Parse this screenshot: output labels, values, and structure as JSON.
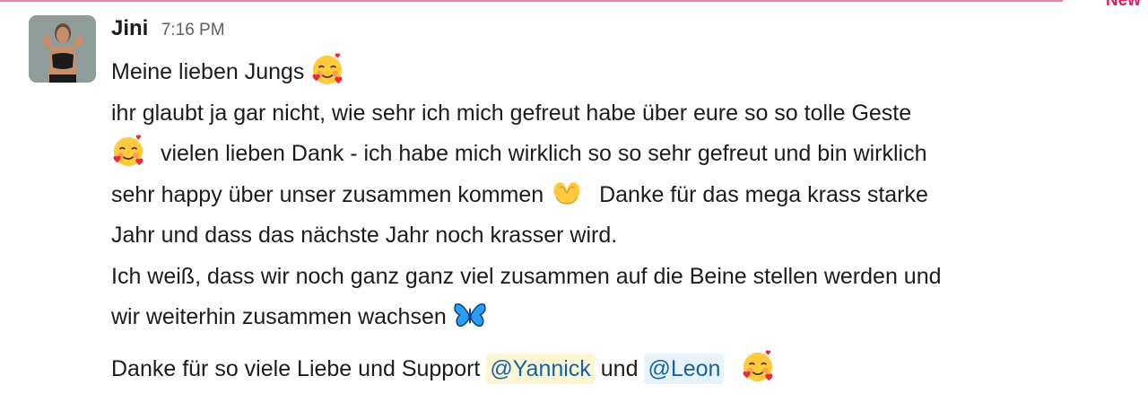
{
  "divider": {
    "label": "New",
    "color": "#e01e5a"
  },
  "message": {
    "sender": "Jini",
    "time": "7:16 PM",
    "avatar_icon": "profile-photo",
    "lines": {
      "l1": "Meine lieben Jungs",
      "l2": "ihr glaubt ja gar nicht, wie sehr ich mich gefreut habe über eure so so tolle Geste",
      "l3": "vielen lieben Dank - ich habe mich wirklich so so sehr gefreut und bin wirklich",
      "l4a": "sehr happy über unser zusammen kommen",
      "l4b": "Danke für das mega krass starke",
      "l5": "Jahr und dass das nächste Jahr noch krasser wird.",
      "l6": "Ich weiß, dass wir noch ganz ganz viel zusammen auf die Beine stellen werden und",
      "l7": "wir weiterhin zusammen wachsen",
      "l8a": "Danke für so viele Liebe und Support",
      "l8b": "und"
    },
    "mentions": {
      "first": "@Yannick",
      "second": "@Leon"
    },
    "emojis": {
      "smiling_hearts": "smiling-face-with-hearts-icon",
      "heart_hands": "heart-hands-icon",
      "butterfly": "butterfly-icon"
    },
    "colors": {
      "link": "#1264a3",
      "mention_highlight_self": "#fdf4d4",
      "mention_highlight": "#e8f2fa",
      "timestamp": "#616061"
    }
  }
}
